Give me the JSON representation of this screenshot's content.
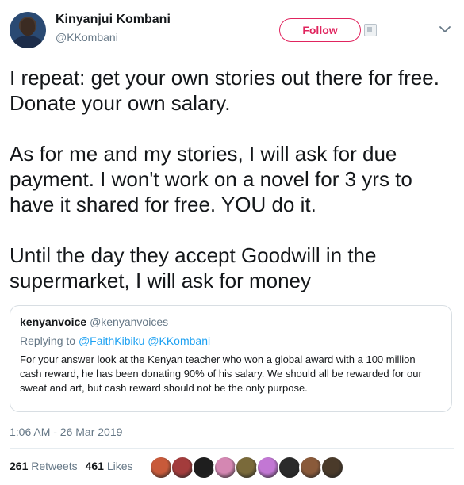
{
  "author": {
    "name": "Kinyanjui Kombani",
    "handle": "@KKombani",
    "follow_label": "Follow"
  },
  "tweet": {
    "paragraphs": [
      "I repeat: get your own stories out there for free. Donate your own salary.",
      "As for me and my stories, I will ask for due payment. I won't work on a novel for 3 yrs to have it shared for free. YOU do it.",
      "Until the day they accept Goodwill in the supermarket, I will ask for money"
    ]
  },
  "quoted": {
    "name": "kenyanvoice",
    "handle": "@kenyanvoices",
    "replying_prefix": "Replying to",
    "replying_to": "@FaithKibiku @KKombani",
    "text": "For your answer look at the Kenyan teacher who won a global award with a 100 million cash reward, he has been donating 90% of his salary.  We should all be rewarded for our sweat and art, but cash reward should not be the only purpose."
  },
  "timestamp": "1:06 AM - 26 Mar 2019",
  "stats": {
    "retweets_count": "261",
    "retweets_label": "Retweets",
    "likes_count": "461",
    "likes_label": "Likes"
  },
  "colors": {
    "follow_accent": "#e0245e",
    "link": "#1da1f2",
    "muted": "#657786"
  },
  "liker_colors": [
    "#c85a3a",
    "#a33c3c",
    "#1e1e1e",
    "#d487b2",
    "#7a6a3a",
    "#c277d4",
    "#2b2b2b",
    "#8a5a3a",
    "#4a3a2a"
  ]
}
